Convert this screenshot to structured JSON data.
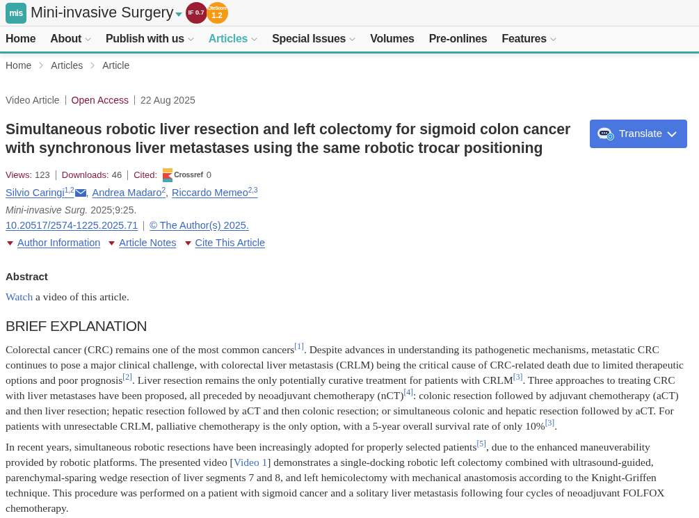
{
  "header": {
    "logo": "mis",
    "title": "Mini-invasive Surgery",
    "badges": [
      {
        "kind": "impact_factor",
        "label": "IF 0.7"
      },
      {
        "kind": "citescore",
        "label": "CiteScore",
        "value": "1.2"
      }
    ]
  },
  "nav": [
    {
      "label": "Home",
      "dropdown": false,
      "selected": false
    },
    {
      "label": "About",
      "dropdown": true,
      "selected": false
    },
    {
      "label": "Publish with us",
      "dropdown": true,
      "selected": false
    },
    {
      "label": "Articles",
      "dropdown": true,
      "selected": true
    },
    {
      "label": "Special Issues",
      "dropdown": true,
      "selected": false
    },
    {
      "label": "Volumes",
      "dropdown": false,
      "selected": false
    },
    {
      "label": "Pre-onlines",
      "dropdown": false,
      "selected": false
    },
    {
      "label": "Features",
      "dropdown": true,
      "selected": false
    }
  ],
  "breadcrumb": [
    "Home",
    "Articles",
    "Article"
  ],
  "article": {
    "type": "Video Article",
    "access": "Open Access",
    "date": "22 Aug 2025",
    "title": "Simultaneous robotic liver resection and left colectomy for sigmoid colon cancer with synchronous liver metastases using the same robotic trocar positioning",
    "translate_button": "Translate",
    "metrics": [
      {
        "kind": "count",
        "label": "Views:",
        "value": "123"
      },
      {
        "kind": "count",
        "label": "Downloads:",
        "value": "46"
      },
      {
        "kind": "crossref",
        "label": "Cited:",
        "source": "Crossref",
        "value": "0"
      }
    ],
    "authors": [
      {
        "name": "Silvio Caringi",
        "affiliations": "1,2",
        "email": true,
        "separator": ","
      },
      {
        "name": "Andrea Madaro",
        "affiliations": "2",
        "email": false,
        "separator": ","
      },
      {
        "name": "Riccardo Memeo",
        "affiliations": "2,3",
        "email": false
      }
    ],
    "citation": "*Mini-invasive Surg.* 2025;9:25.",
    "doi": "10.20517/2574-1225.2025.71",
    "license": "© The Author(s) 2025.",
    "toggles": [
      "Author Information",
      "Article Notes",
      "Cite This Article"
    ]
  },
  "abstract": {
    "heading": "Abstract",
    "segments": [
      {
        "kind": "link",
        "text": "Watch"
      },
      {
        "kind": "text",
        "text": " a video of this article."
      }
    ]
  },
  "section": {
    "heading": "BRIEF EXPLANATION",
    "paragraphs": [
      [
        {
          "kind": "text",
          "text": "Colorectal cancer (CRC) remains one of the most common cancers"
        },
        {
          "kind": "cite",
          "text": "[1]"
        },
        {
          "kind": "text",
          "text": ". Despite advances in understanding its pathogenetic mechanisms, metastatic CRC continues to pose a major clinical challenge, with colorectal liver metastasis (CRLM) being the critical cause of CRC-related death due to limited therapeutic options and poor prognosis"
        },
        {
          "kind": "cite",
          "text": "[2]"
        },
        {
          "kind": "text",
          "text": ". Liver resection remains the only potentially curative treatment for patients with CRLM"
        },
        {
          "kind": "cite",
          "text": "[3]"
        },
        {
          "kind": "text",
          "text": ". Three approaches to treating CRC with liver metastases have been proposed, all preceded by neoadjuvant chemotherapy (nCT)"
        },
        {
          "kind": "cite",
          "text": "[4]"
        },
        {
          "kind": "text",
          "text": ": colonic resection followed by adjuvant chemotherapy (aCT) and then liver resection; hepatic resection followed by aCT and then colonic resection; or simultaneous colonic and hepatic resection followed by aCT. For patients with unresectable CRLM, palliative chemotherapy is the only option, with a 5-year overall survival rate of only 10%"
        },
        {
          "kind": "cite",
          "text": "[3]"
        },
        {
          "kind": "text",
          "text": "."
        }
      ],
      [
        {
          "kind": "text",
          "text": "In recent years, simultaneous robotic resections have been increasingly adopted for properly selected patients"
        },
        {
          "kind": "cite",
          "text": "[5]"
        },
        {
          "kind": "text",
          "text": ", due to the enhanced maneuverability provided by robotic platforms. The presented video ["
        },
        {
          "kind": "link",
          "text": "Video 1"
        },
        {
          "kind": "text",
          "text": "] demonstrates a single-docking robotic left colectomy combined with ultrasound-guided, parenchymal-sparing wedge resection of liver segments 7 and 8, and left hemicolectomy with mechanical anastomosis according to the Knight-Griffen technique. This procedure was performed on a patient with sigmoid cancer and a solitary liver metastasis following four cycles of neoadjuvant FOLFOX chemotherapy."
        }
      ]
    ]
  }
}
